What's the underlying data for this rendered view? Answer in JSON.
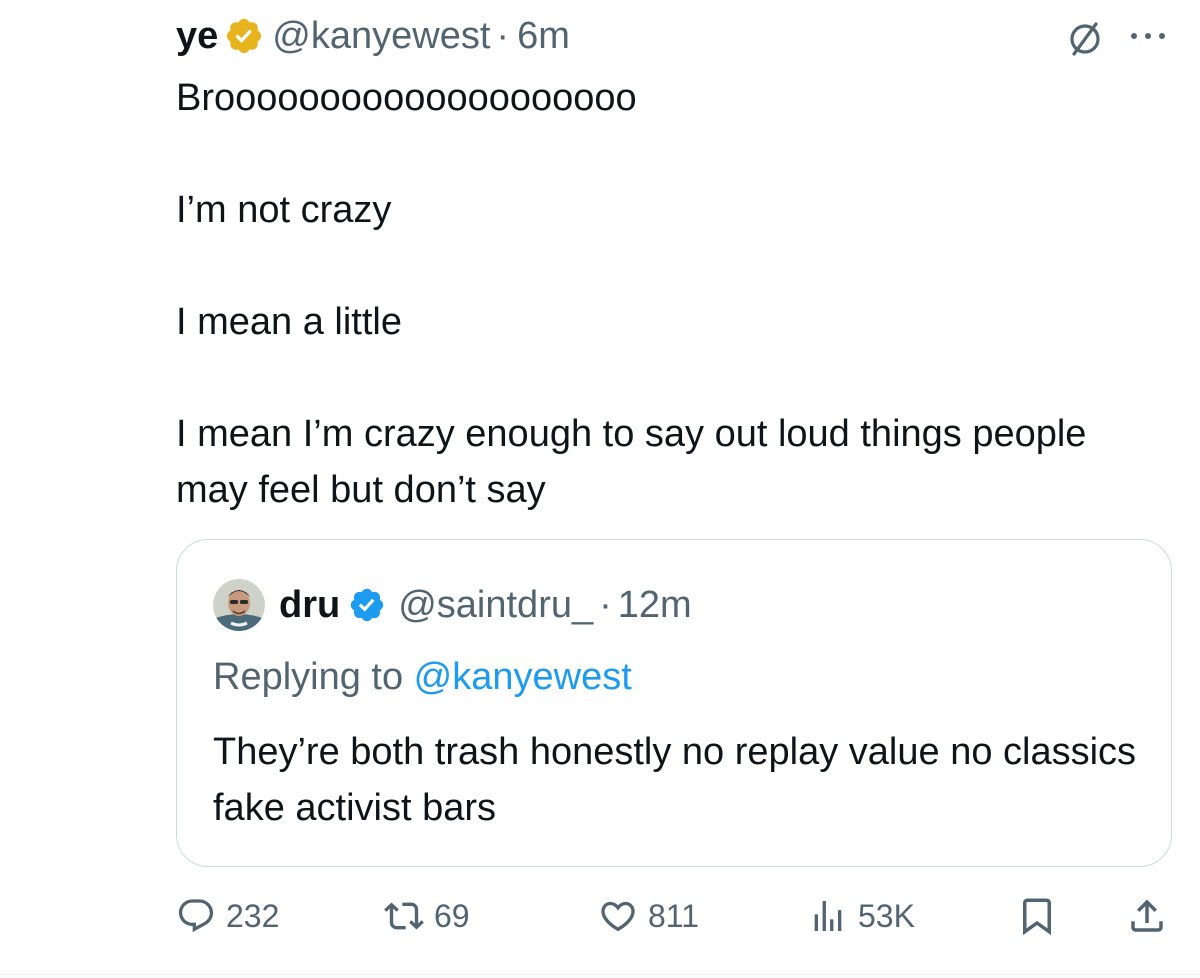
{
  "tweet": {
    "author_name": "ye",
    "handle": "@kanyewest",
    "separator": "·",
    "time": "6m",
    "paragraphs": [
      "Broooooooooooooooooooo",
      "I’m not crazy",
      "I mean a little",
      "I mean I’m crazy enough to say out loud things people may feel but don’t say"
    ]
  },
  "quote": {
    "author_name": "dru",
    "handle": "@saintdru_",
    "separator": "·",
    "time": "12m",
    "replying_prefix": "Replying to ",
    "replying_to": "@kanyewest",
    "text": "They’re both trash honestly no replay value no classics fake activist bars"
  },
  "actions": {
    "replies": "232",
    "reposts": "69",
    "likes": "811",
    "views": "53K"
  },
  "colors": {
    "text": "#0f1419",
    "secondary": "#536471",
    "link": "#1d9bf0",
    "gold_badge": "#e8b41e",
    "blue_badge": "#1d9bf0",
    "border": "#cfd9de"
  },
  "icons": [
    "gold-verified-badge-icon",
    "grok-icon",
    "more-icon",
    "blue-verified-badge-icon",
    "reply-icon",
    "repost-icon",
    "like-icon",
    "views-icon",
    "bookmark-icon",
    "share-icon"
  ]
}
